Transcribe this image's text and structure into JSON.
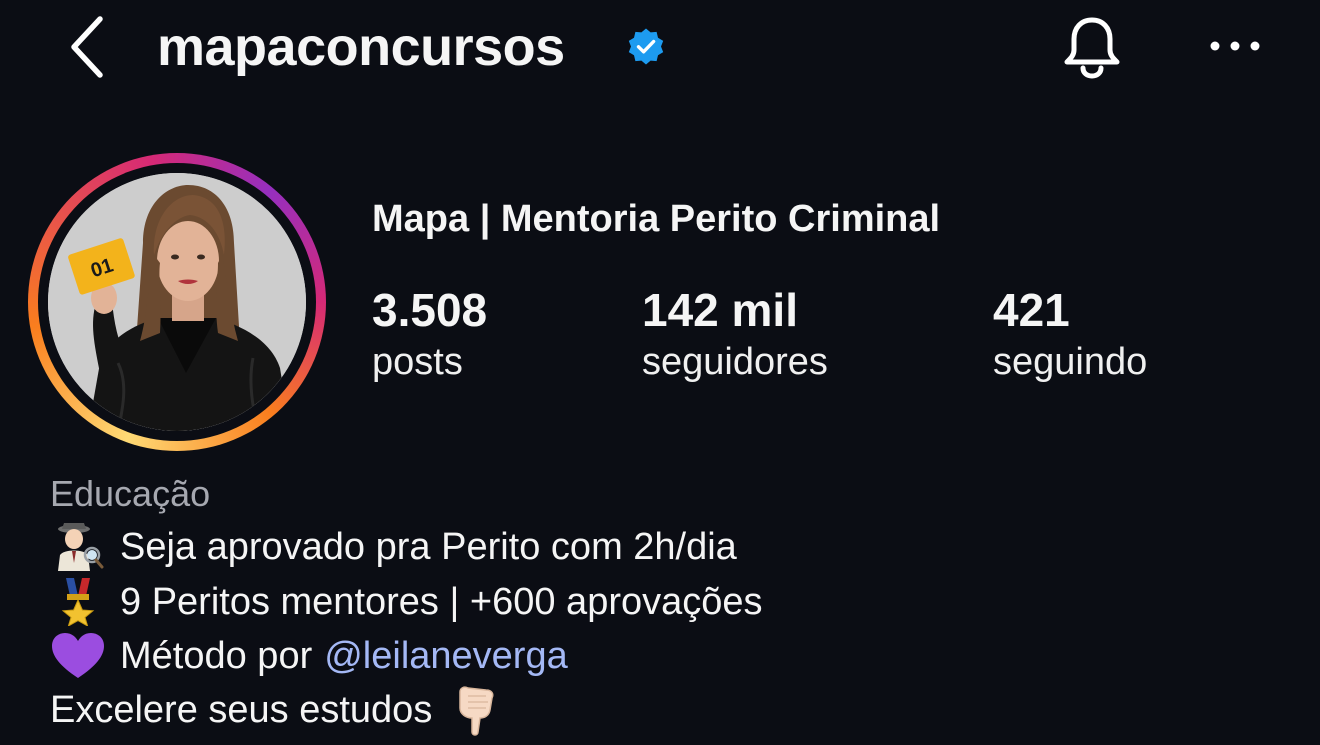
{
  "header": {
    "username": "mapaconcursos",
    "verified_color": "#1d9bf0",
    "back_icon": "chevron-left-icon",
    "bell_icon": "bell-icon",
    "more_icon": "more-horizontal-icon"
  },
  "profile": {
    "display_name": "Mapa | Mentoria Perito Criminal",
    "avatar_badge": "01",
    "stats": {
      "posts": {
        "value": "3.508",
        "label": "posts"
      },
      "followers": {
        "value": "142 mil",
        "label": "seguidores"
      },
      "following": {
        "value": "421",
        "label": "seguindo"
      }
    }
  },
  "bio": {
    "category": "Educação",
    "lines": [
      {
        "emoji": "detective-emoji",
        "text": "Seja aprovado pra Perito com 2h/dia"
      },
      {
        "emoji": "military-medal-emoji",
        "text": "9 Peritos mentores | +600 aprovações"
      },
      {
        "emoji": "purple-heart-emoji",
        "text": "Método por",
        "mention": "@leilaneverga"
      },
      {
        "text": "Excelere seus estudos",
        "trail_emoji": "pointing-down-emoji"
      }
    ]
  },
  "colors": {
    "background": "#0b0d14",
    "text": "#f5f5f5",
    "muted": "#a6a8b0",
    "link": "#a4b8f5"
  }
}
